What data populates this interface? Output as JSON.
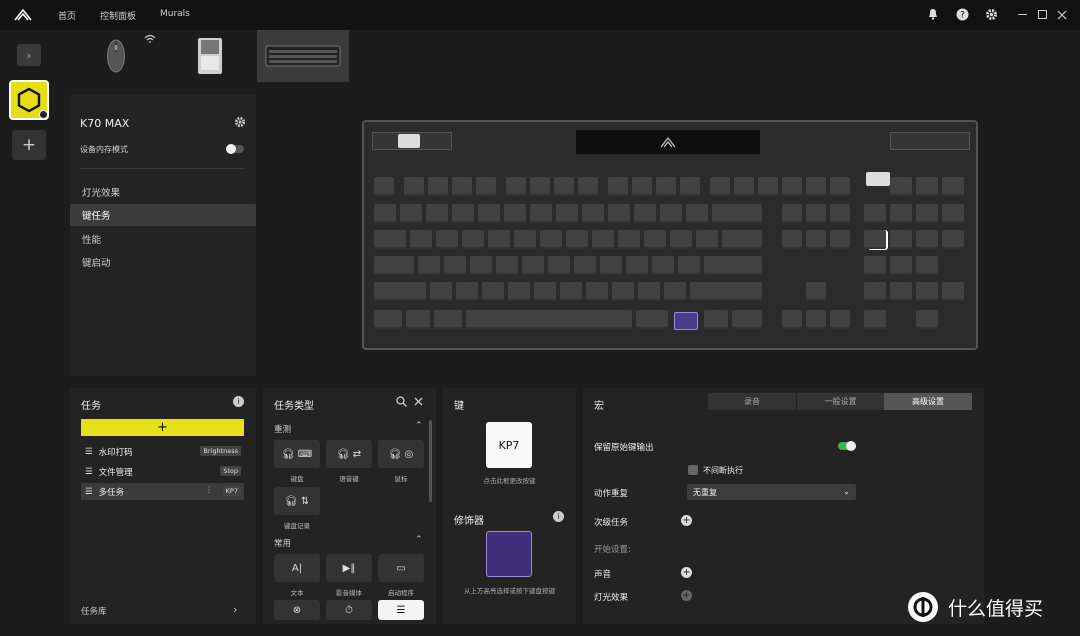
{
  "topbar": {
    "nav": [
      "首页",
      "控制面板",
      "Murals"
    ],
    "window_controls": [
      "minimize",
      "maximize",
      "close"
    ],
    "icons": [
      "bell-icon",
      "help-icon",
      "gear-icon"
    ]
  },
  "rail": {
    "collapse": "›",
    "add": "+"
  },
  "device": {
    "name": "K70 MAX",
    "memory_mode": "设备内存模式",
    "menu": [
      "灯光效果",
      "键任务",
      "性能",
      "键启动"
    ],
    "active_menu": 1
  },
  "tasks": {
    "title": "任务",
    "add": "+",
    "items": [
      {
        "label": "水印打码",
        "badge": "Brightness"
      },
      {
        "label": "文件管理",
        "badge": "Stop"
      },
      {
        "label": "多任务",
        "badge": "KP7"
      }
    ],
    "library": "任务库"
  },
  "task_types": {
    "title": "任务类型",
    "cat1": "重测",
    "cat1_items": [
      "键盘",
      "语音键",
      "鼠标",
      "键盘记录"
    ],
    "cat2": "常用",
    "cat2_items": [
      "文本",
      "影音媒体",
      "启动程序"
    ]
  },
  "key_panel": {
    "title": "键",
    "key": "KP7",
    "hint": "点击此框更改按键",
    "modifier_title": "修饰器",
    "modifier_hint": "从上方高亮选择或按下键盘按键"
  },
  "macro": {
    "title": "宏",
    "tabs": [
      "录音",
      "一般设置",
      "高级设置"
    ],
    "active_tab": 2,
    "keep_output": "保留原始键输出",
    "no_interrupt": "不间断执行",
    "repeat_label": "动作重复",
    "repeat_value": "无重复",
    "secondary": "次级任务",
    "start_settings": "开始设置:",
    "sound": "声音",
    "lighting": "灯光效果"
  },
  "watermark": "什么值得买"
}
